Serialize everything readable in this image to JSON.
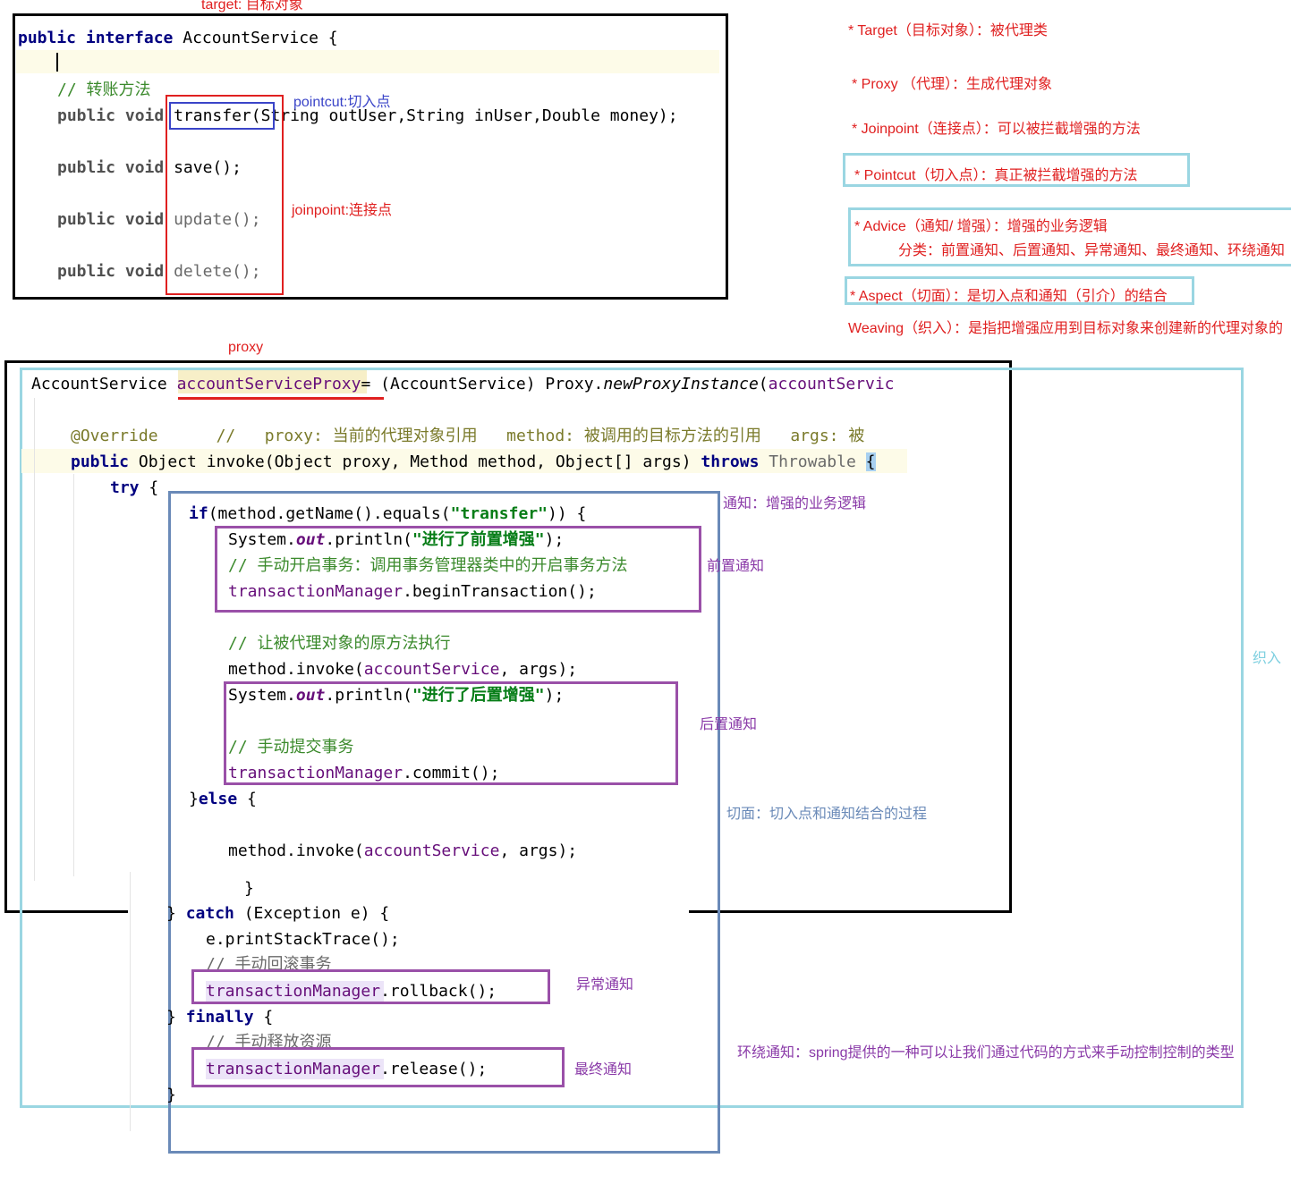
{
  "labels": {
    "target_label": "target: 目标对象",
    "pointcut_label": "pointcut:切入点",
    "joinpoint_label": "joinpoint:连接点",
    "proxy_label": "proxy",
    "advice_label": "通知：增强的业务逻辑",
    "before_label": "前置通知",
    "after_label": "后置通知",
    "aspect_label": "切面：切入点和通知结合的过程",
    "weaving_label": "织入",
    "exception_label": "异常通知",
    "final_label": "最终通知",
    "around_label": "环绕通知：spring提供的一种可以让我们通过代码的方式来手动控制控制的类型"
  },
  "definitions": [
    "* Target（目标对象）：被代理类",
    "* Proxy （代理）：生成代理对象",
    "* Joinpoint（连接点）：可以被拦截增强的方法",
    "* Pointcut（切入点）：真正被拦截增强的方法",
    "* Advice（通知/ 增强）：增强的业务逻辑",
    "分类：前置通知、后置通知、异常通知、最终通知、环绕通知",
    "* Aspect（切面）：是切入点和通知（引介）的结合",
    "Weaving（织入）：是指把增强应用到目标对象来创建新的代理对象的"
  ],
  "interface_code": {
    "l1_kw": "public interface",
    "l1_rest": " AccountService {",
    "comment": "// 转账方法",
    "pv": "public void",
    "m1_name": "transfer(",
    "m1_args": "String outUser,String inUser,Double money);",
    "m2": "save();",
    "m3": "update();",
    "m4": "delete();"
  },
  "proxy_code": {
    "l1_a": "AccountService ",
    "l1_var": "accountServiceProxy",
    "l1_b": "= (AccountService) Proxy.",
    "l1_m": "newProxyInstance",
    "l1_c": "(",
    "l1_f": "accountServic",
    "override": "@Override",
    "override_comment": "//   proxy: 当前的代理对象引用   method: 被调用的目标方法的引用   args: 被",
    "inv_kw": "public",
    "inv_rest": " Object invoke(Object proxy, Method method, Object[] args) ",
    "inv_throws": "throws",
    "inv_thr": " Throwable ",
    "inv_brace": "{",
    "try": "try",
    "try_brace": " {",
    "if_kw": "if",
    "if_a": "(method.getName().equals(",
    "if_str": "\"transfer\"",
    "if_b": ")) {",
    "sys": "System.",
    "out": "out",
    "println": ".println(",
    "str_before": "\"进行了前置增强\"",
    "close": ");",
    "c_begin": "// 手动开启事务：调用事务管理器类中的开启事务方法",
    "tm": "transactionManager",
    "begin": ".beginTransaction();",
    "c_invoke": "// 让被代理对象的原方法执行",
    "mi_a": "method.invoke(",
    "mi_f": "accountService",
    "mi_b": ", args);",
    "str_after": "\"进行了后置增强\"",
    "c_commit": "// 手动提交事务",
    "commit": ".commit();",
    "else_a": "}",
    "else_kw": "else",
    "else_b": " {",
    "brace1": "}",
    "brace2": "}",
    "catch_a": "} ",
    "catch_kw": "catch",
    "catch_b": " (Exception e) {",
    "pst": "e.printStackTrace();",
    "c_rollback": "// 手动回滚事务",
    "rollback": ".rollback();",
    "finally_a": "} ",
    "finally_kw": "finally",
    "finally_b": " {",
    "c_release": "// 手动释放资源",
    "release": ".release();",
    "end_brace": "}"
  }
}
